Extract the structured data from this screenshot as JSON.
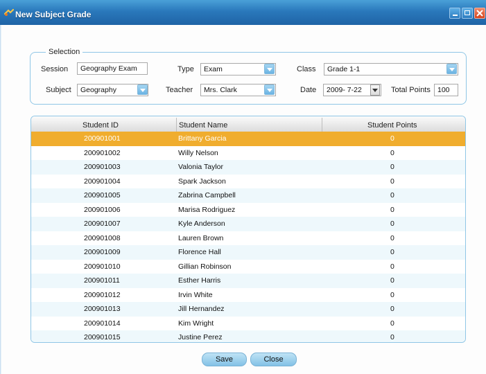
{
  "window": {
    "title": "New Subject Grade"
  },
  "selection": {
    "legend": "Selection",
    "session_label": "Session",
    "session_value": "Geography Exam",
    "type_label": "Type",
    "type_value": "Exam",
    "class_label": "Class",
    "class_value": "Grade 1-1",
    "subject_label": "Subject",
    "subject_value": "Geography",
    "teacher_label": "Teacher",
    "teacher_value": "Mrs. Clark",
    "date_label": "Date",
    "date_value": "2009- 7-22",
    "total_points_label": "Total Points",
    "total_points_value": "100"
  },
  "grid": {
    "columns": [
      "Student ID",
      "Student Name",
      "Student Points"
    ],
    "rows": [
      {
        "id": "200901001",
        "name": "Brittany Garcia",
        "points": "0"
      },
      {
        "id": "200901002",
        "name": "Willy Nelson",
        "points": "0"
      },
      {
        "id": "200901003",
        "name": "Valonia Taylor",
        "points": "0"
      },
      {
        "id": "200901004",
        "name": "Spark Jackson",
        "points": "0"
      },
      {
        "id": "200901005",
        "name": "Zabrina Campbell",
        "points": "0"
      },
      {
        "id": "200901006",
        "name": "Marisa Rodriguez",
        "points": "0"
      },
      {
        "id": "200901007",
        "name": "Kyle Anderson",
        "points": "0"
      },
      {
        "id": "200901008",
        "name": "Lauren Brown",
        "points": "0"
      },
      {
        "id": "200901009",
        "name": "Florence Hall",
        "points": "0"
      },
      {
        "id": "200901010",
        "name": "Gillian Robinson",
        "points": "0"
      },
      {
        "id": "200901011",
        "name": "Esther Harris",
        "points": "0"
      },
      {
        "id": "200901012",
        "name": "Irvin White",
        "points": "0"
      },
      {
        "id": "200901013",
        "name": "Jill  Hernandez",
        "points": "0"
      },
      {
        "id": "200901014",
        "name": "Kim Wright",
        "points": "0"
      },
      {
        "id": "200901015",
        "name": "Justine Perez",
        "points": "0"
      }
    ]
  },
  "buttons": {
    "save_label": "Save",
    "close_label": "Close"
  },
  "colors": {
    "titlebar": "#2a78bb",
    "selected_row": "#f0ad2e",
    "alt_row": "#eef8fc",
    "border_accent": "#8fc6e6",
    "button": "#83c2e6"
  },
  "icons": [
    "app-icon",
    "minimize-icon",
    "maximize-icon",
    "close-icon",
    "dropdown-arrow-icon",
    "calendar-dropdown-icon"
  ]
}
